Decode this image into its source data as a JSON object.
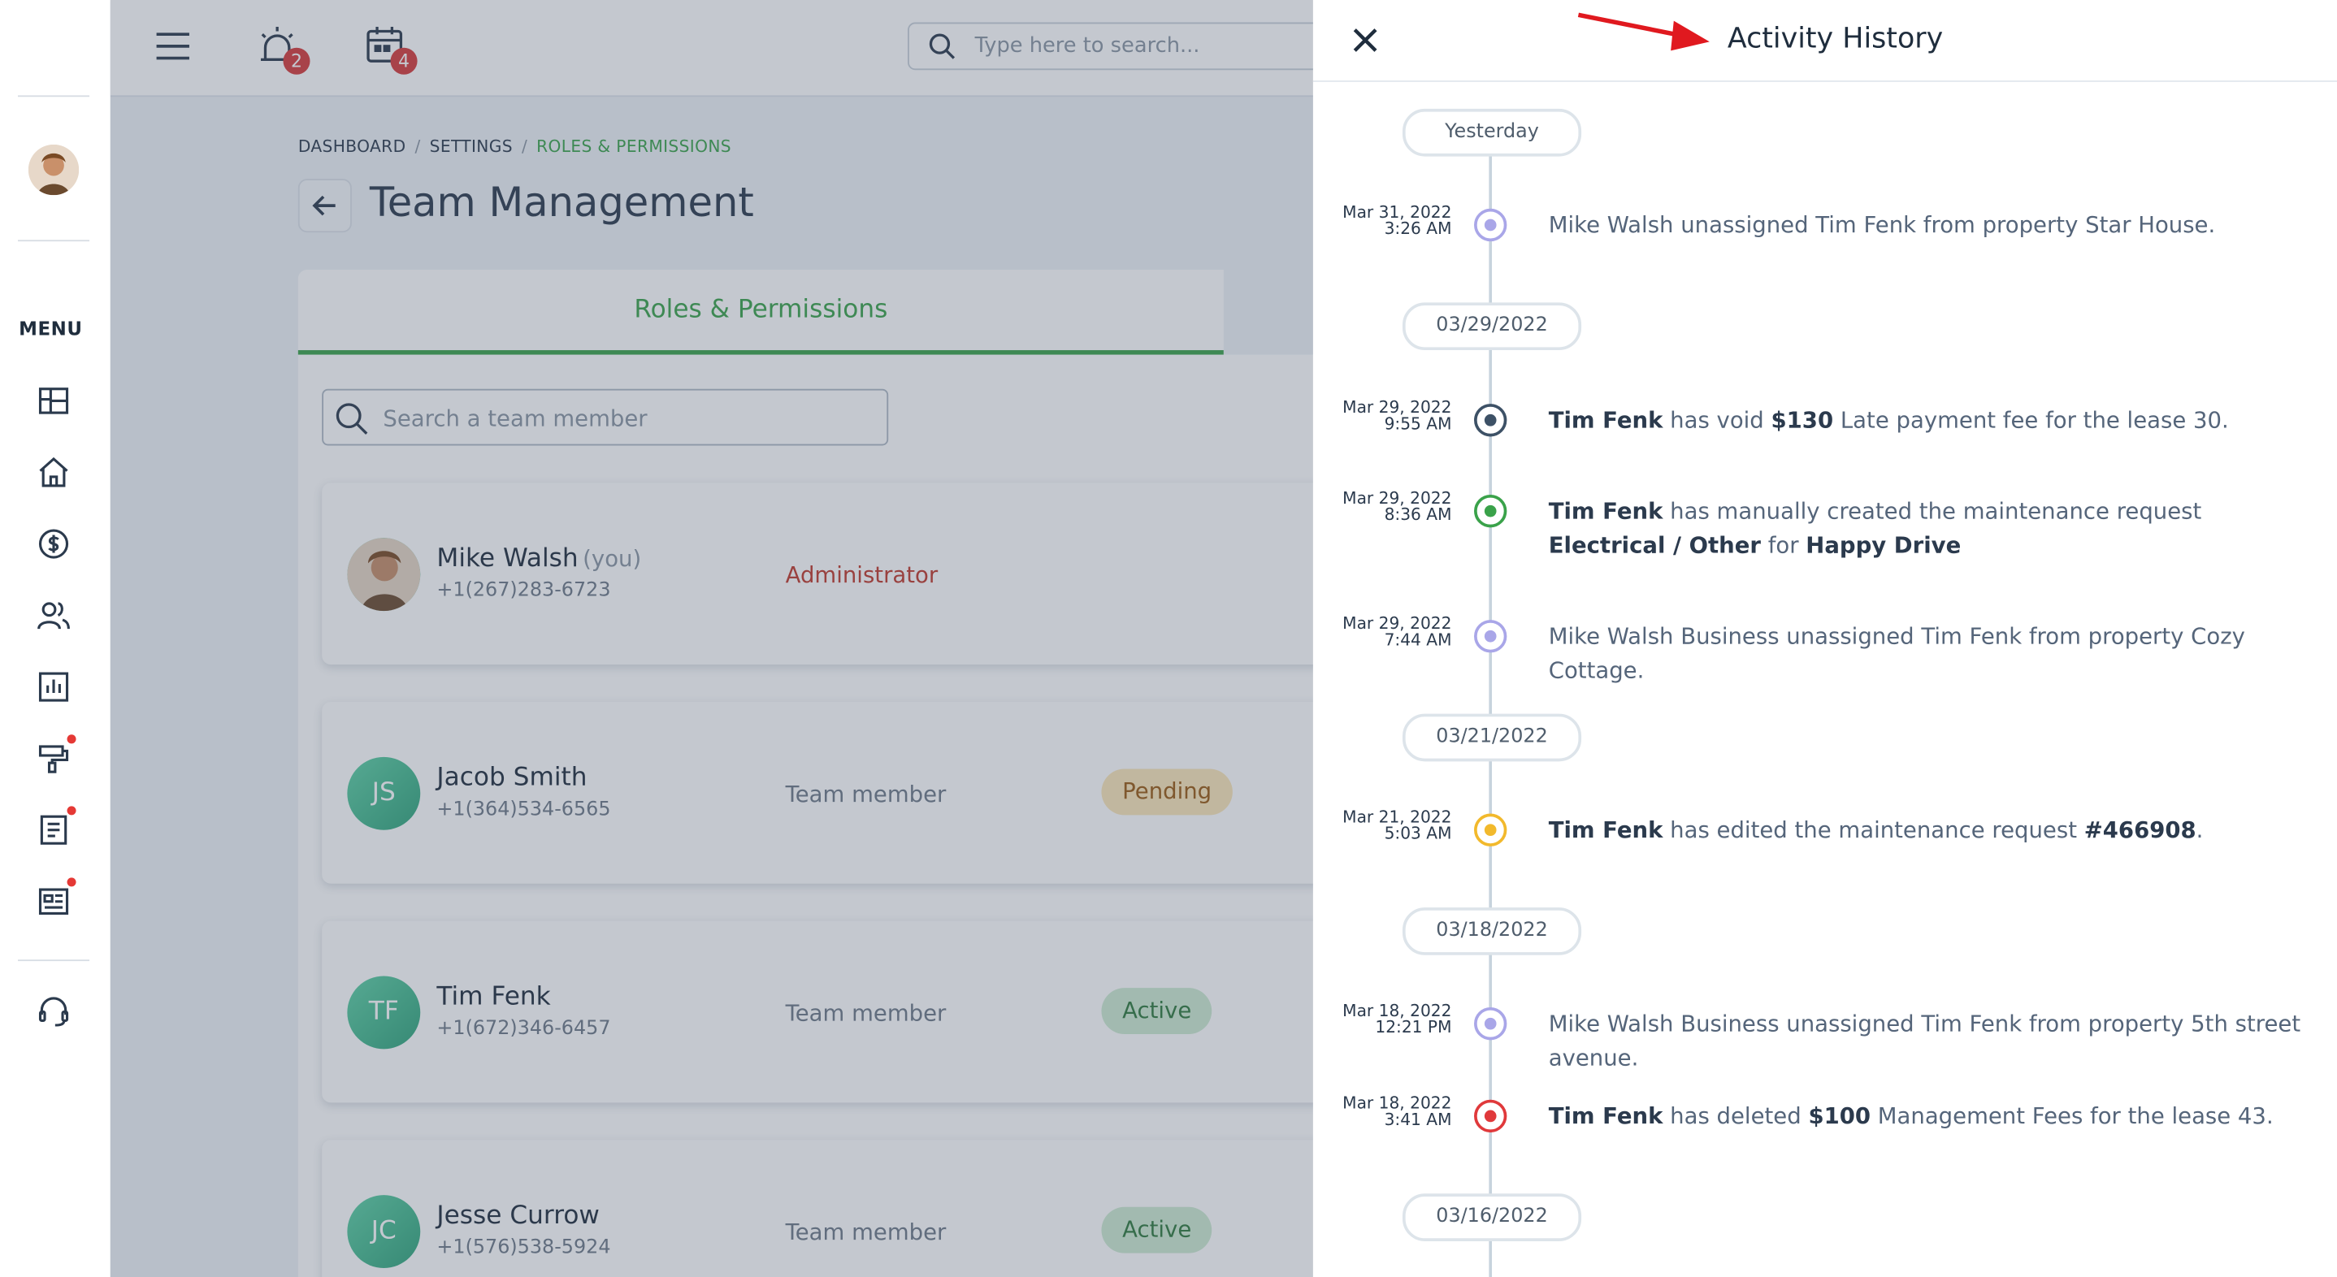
{
  "sidebar": {
    "menu_label": "MENU",
    "items": [
      "dashboard-icon",
      "home-icon",
      "dollar-icon",
      "people-icon",
      "report-icon",
      "maintenance-icon",
      "documents-icon",
      "news-icon",
      "support-icon"
    ]
  },
  "topbar": {
    "alerts_badge": "2",
    "calendar_badge": "4",
    "search_placeholder": "Type here to search..."
  },
  "breadcrumb": {
    "items": [
      "DASHBOARD",
      "SETTINGS",
      "ROLES & PERMISSIONS"
    ]
  },
  "page": {
    "title": "Team Management"
  },
  "tabs": {
    "active": "Roles & Permissions"
  },
  "member_search": {
    "placeholder": "Search a team member"
  },
  "members": [
    {
      "name": "Mike Walsh",
      "you": "(you)",
      "phone": "+1(267)283-6723",
      "role": "Administrator",
      "status": ""
    },
    {
      "initials": "JS",
      "name": "Jacob Smith",
      "phone": "+1(364)534-6565",
      "role": "Team member",
      "status": "Pending"
    },
    {
      "initials": "TF",
      "name": "Tim Fenk",
      "phone": "+1(672)346-6457",
      "role": "Team member",
      "status": "Active"
    },
    {
      "initials": "JC",
      "name": "Jesse Currow",
      "phone": "+1(576)538-5924",
      "role": "Team member",
      "status": "Active"
    }
  ],
  "drawer": {
    "title": "Activity History",
    "date_groups": [
      "Yesterday",
      "03/29/2022",
      "03/21/2022",
      "03/18/2022",
      "03/16/2022"
    ],
    "events": [
      {
        "date": "Mar 31, 2022",
        "time": "3:26 AM",
        "color": "#a9a6e8",
        "parts": [
          {
            "t": "Mike Walsh unassigned Tim Fenk from property Star House."
          }
        ]
      },
      {
        "date": "Mar 29, 2022",
        "time": "9:55 AM",
        "color": "#3d5166",
        "parts": [
          {
            "t": "Tim Fenk",
            "b": true
          },
          {
            "t": " has void "
          },
          {
            "t": "$130",
            "b": true
          },
          {
            "t": " Late payment fee for the lease 30."
          }
        ]
      },
      {
        "date": "Mar 29, 2022",
        "time": "8:36 AM",
        "color": "#3aa24a",
        "parts": [
          {
            "t": "Tim Fenk",
            "b": true
          },
          {
            "t": " has manually created the maintenance request "
          },
          {
            "t": "Electrical / Other",
            "b": true
          },
          {
            "t": " for "
          },
          {
            "t": "Happy Drive",
            "b": true
          }
        ]
      },
      {
        "date": "Mar 29, 2022",
        "time": "7:44 AM",
        "color": "#a9a6e8",
        "parts": [
          {
            "t": "Mike Walsh Business unassigned Tim Fenk from property Cozy Cottage."
          }
        ]
      },
      {
        "date": "Mar 21, 2022",
        "time": "5:03 AM",
        "color": "#f2b92c",
        "parts": [
          {
            "t": "Tim Fenk",
            "b": true
          },
          {
            "t": " has edited the maintenance request "
          },
          {
            "t": "#466908",
            "b": true
          },
          {
            "t": "."
          }
        ]
      },
      {
        "date": "Mar 18, 2022",
        "time": "12:21 PM",
        "color": "#a9a6e8",
        "parts": [
          {
            "t": "Mike Walsh Business unassigned Tim Fenk from property 5th street avenue."
          }
        ]
      },
      {
        "date": "Mar 18, 2022",
        "time": "3:41 AM",
        "color": "#e0393b",
        "parts": [
          {
            "t": "Tim Fenk",
            "b": true
          },
          {
            "t": " has deleted "
          },
          {
            "t": "$100",
            "b": true
          },
          {
            "t": " Management Fees for the lease 43."
          }
        ]
      }
    ]
  }
}
